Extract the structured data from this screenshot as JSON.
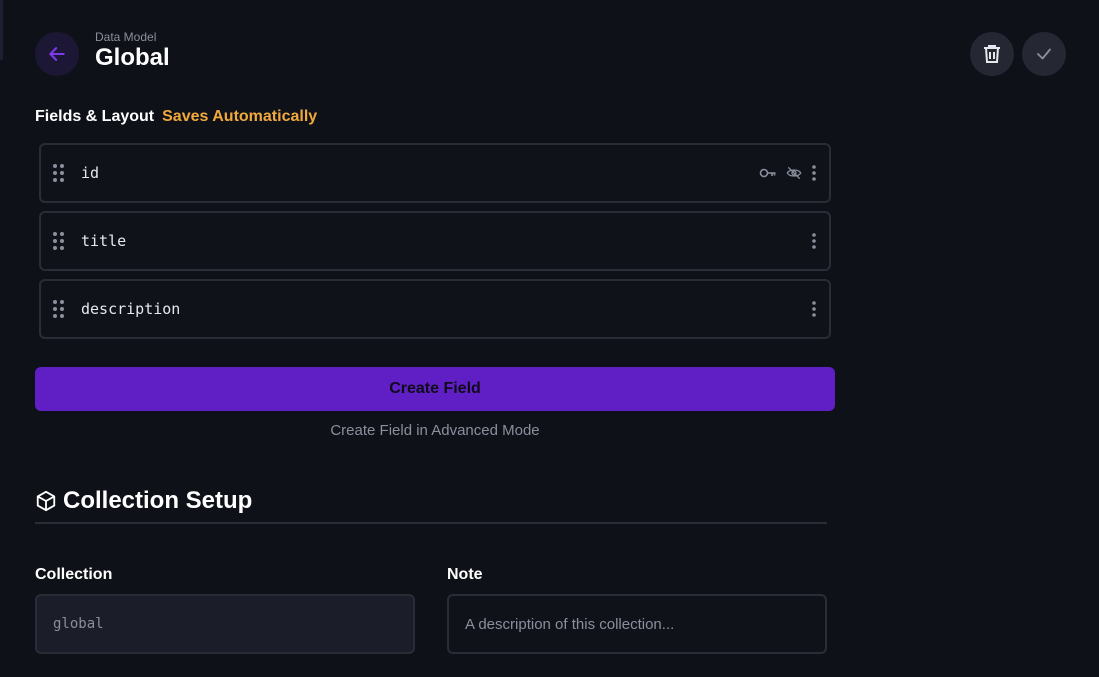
{
  "header": {
    "breadcrumb": "Data Model",
    "title": "Global"
  },
  "fields_section": {
    "label": "Fields & Layout",
    "status": "Saves Automatically"
  },
  "fields": [
    {
      "name": "id",
      "icons": [
        "key-icon",
        "eye-off-icon",
        "more-vertical-icon"
      ]
    },
    {
      "name": "title",
      "icons": [
        "more-vertical-icon"
      ]
    },
    {
      "name": "description",
      "icons": [
        "more-vertical-icon"
      ]
    }
  ],
  "actions": {
    "create_field": "Create Field",
    "create_advanced": "Create Field in Advanced Mode"
  },
  "setup": {
    "heading": "Collection Setup",
    "collection_label": "Collection",
    "collection_value": "global",
    "note_label": "Note",
    "note_placeholder": "A description of this collection..."
  },
  "colors": {
    "background": "#0f1119",
    "accent": "#5f1fc4",
    "warning": "#f2a93b"
  }
}
